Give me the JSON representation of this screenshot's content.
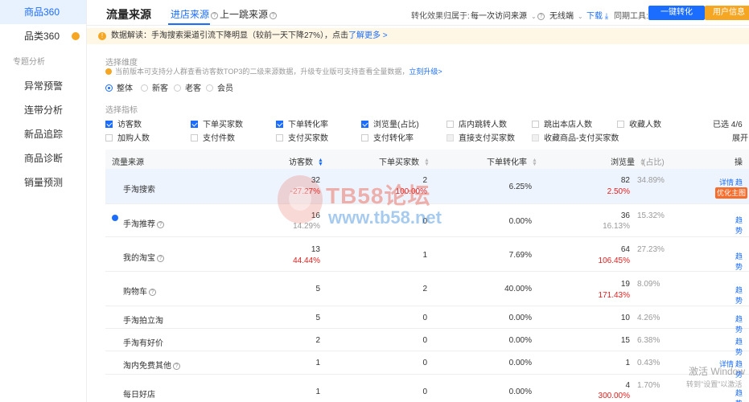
{
  "sidebar": {
    "top_item": "商品360",
    "items": [
      {
        "label": "品类360"
      }
    ],
    "group_label": "专题分析",
    "group_items": [
      {
        "label": "异常预警"
      },
      {
        "label": "连带分析"
      },
      {
        "label": "新品追踪"
      },
      {
        "label": "商品诊断"
      },
      {
        "label": "销量预测"
      }
    ]
  },
  "header": {
    "title": "流量来源",
    "tabs": [
      {
        "label": "进店来源"
      },
      {
        "label": "上一跳来源"
      }
    ],
    "attribution_label": "转化效果归属于:",
    "attribution_value": "每一次访问来源",
    "device_value": "无线端",
    "download_label": "下载",
    "sync_label": "同期工具:",
    "one_click_button": "一键转化",
    "user_info_button": "用户信息"
  },
  "notice": {
    "text": "数据解读：手淘搜索渠道引流下降明显（较前一天下降27%），点击",
    "link": "了解更多 >"
  },
  "dimension": {
    "label": "选择维度",
    "tip": "当前版本可支持分人群查看访客数TOP3的二级来源数据，升级专业版可支持查看全量数据，",
    "tip_link": "立刻升级>",
    "options": [
      "整体",
      "新客",
      "老客",
      "会员"
    ]
  },
  "metrics": {
    "label": "选择指标",
    "row1": [
      {
        "label": "访客数",
        "checked": true
      },
      {
        "label": "下单买家数",
        "checked": true
      },
      {
        "label": "下单转化率",
        "checked": true
      },
      {
        "label": "浏览量(占比)",
        "checked": true
      },
      {
        "label": "店内跳转人数",
        "checked": false
      },
      {
        "label": "跳出本店人数",
        "checked": false
      },
      {
        "label": "收藏人数",
        "checked": false
      }
    ],
    "row2": [
      {
        "label": "加购人数",
        "checked": false
      },
      {
        "label": "支付件数",
        "checked": false
      },
      {
        "label": "支付买家数",
        "checked": false
      },
      {
        "label": "支付转化率",
        "checked": false
      },
      {
        "label": "直接支付买家数",
        "checked": false
      },
      {
        "label": "收藏商品-支付买家数",
        "checked": false
      }
    ],
    "selected_count": "已选 4/6",
    "expand_label": "展开"
  },
  "table": {
    "headers": {
      "source": "流量来源",
      "visitors": "访客数",
      "buyers": "下单买家数",
      "conversion": "下单转化率",
      "pageviews": "浏览量",
      "share": "(占比)",
      "actions": "操作"
    },
    "rows": [
      {
        "source": "手淘搜索",
        "visitors": "32",
        "visitors_change": "-27.27%",
        "buyers": "2",
        "buyers_change": "100.00%",
        "conversion": "6.25%",
        "pageviews": "82",
        "pageviews_change": "2.50%",
        "share": "34.89%",
        "detail": "详情",
        "trend": "趋势",
        "optimize": "优化主图"
      },
      {
        "source": "手淘推荐",
        "visitors": "16",
        "visitors_change": "14.29%",
        "buyers": "0",
        "conversion": "0.00%",
        "pageviews": "36",
        "pageviews_change": "16.13%",
        "share": "15.32%",
        "trend": "趋势"
      },
      {
        "source": "我的淘宝",
        "visitors": "13",
        "visitors_change": "44.44%",
        "buyers": "1",
        "conversion": "7.69%",
        "pageviews": "64",
        "pageviews_change": "106.45%",
        "share": "27.23%",
        "trend": "趋势"
      },
      {
        "source": "购物车",
        "visitors": "5",
        "buyers": "2",
        "conversion": "40.00%",
        "pageviews": "19",
        "pageviews_change": "171.43%",
        "share": "8.09%",
        "trend": "趋势"
      },
      {
        "source": "手淘拍立淘",
        "visitors": "5",
        "buyers": "0",
        "conversion": "0.00%",
        "pageviews": "10",
        "share": "4.26%",
        "trend": "趋势"
      },
      {
        "source": "手淘有好价",
        "visitors": "2",
        "buyers": "0",
        "conversion": "0.00%",
        "pageviews": "15",
        "share": "6.38%",
        "trend": "趋势"
      },
      {
        "source": "淘内免费其他",
        "visitors": "1",
        "buyers": "0",
        "conversion": "0.00%",
        "pageviews": "1",
        "share": "0.43%",
        "detail": "详情",
        "trend": "趋势"
      },
      {
        "source": "每日好店",
        "visitors": "1",
        "buyers": "0",
        "conversion": "0.00%",
        "pageviews": "4",
        "pageviews_change": "300.00%",
        "share": "1.70%",
        "trend": "趋势"
      }
    ]
  },
  "watermark": {
    "title": "TB58论坛",
    "url": "www.tb58.net"
  },
  "activation": {
    "line1": "激活 Window",
    "line2": "转到\"设置\"以激活"
  },
  "colors": {
    "accent": "#1a6dff",
    "orange": "#f5a623",
    "negative": "#e02020"
  }
}
